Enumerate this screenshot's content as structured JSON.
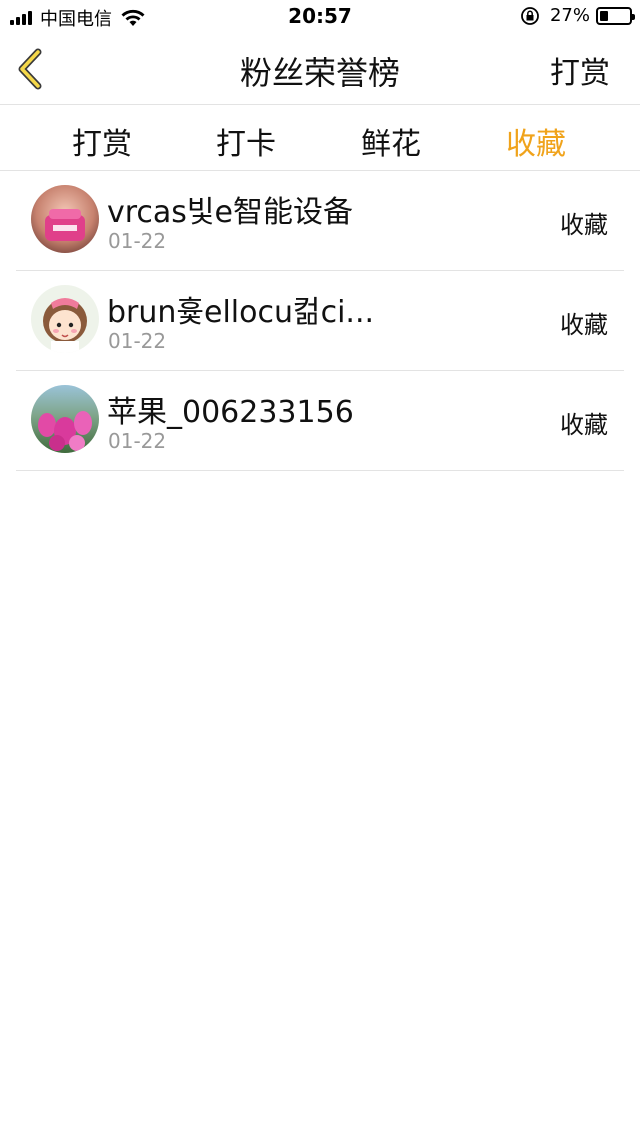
{
  "status_bar": {
    "carrier": "中国电信",
    "time": "20:57",
    "battery_percent": "27%",
    "battery_level": 0.27
  },
  "nav": {
    "title": "粉丝荣誉榜",
    "right_label": "打赏"
  },
  "tabs": [
    {
      "label": "打赏",
      "active": false
    },
    {
      "label": "打卡",
      "active": false
    },
    {
      "label": "鲜花",
      "active": false
    },
    {
      "label": "收藏",
      "active": true
    }
  ],
  "colors": {
    "accent": "#f0a31b",
    "divider": "#e3e3e3",
    "secondary_text": "#999999"
  },
  "list": [
    {
      "name": "vrcas빛e智能设备",
      "date": "01-22",
      "action": "收藏",
      "avatar_icon": "avatar-photo-pink-object"
    },
    {
      "name": "brun흋ellocu컮ci...",
      "date": "01-22",
      "action": "收藏",
      "avatar_icon": "avatar-cartoon-girl"
    },
    {
      "name": "苹果_006233156",
      "date": "01-22",
      "action": "收藏",
      "avatar_icon": "avatar-photo-flowers"
    }
  ]
}
